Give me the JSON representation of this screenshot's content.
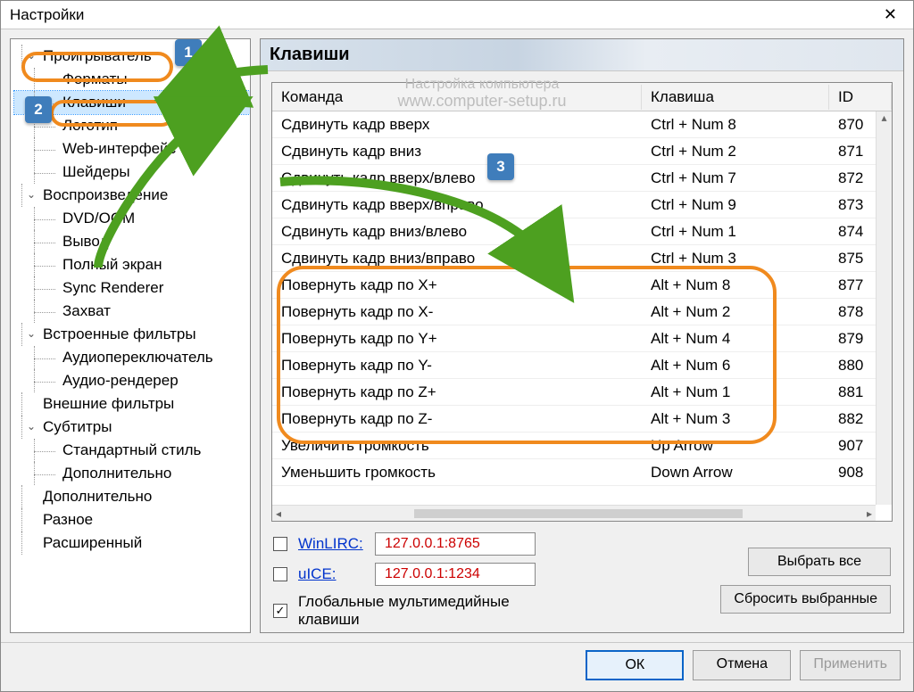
{
  "window": {
    "title": "Настройки"
  },
  "nav": {
    "tree": [
      {
        "label": "Проигрыватель",
        "expandable": true,
        "children": [
          {
            "label": "Форматы"
          },
          {
            "label": "Клавиши",
            "selected": true
          },
          {
            "label": "Логотип"
          },
          {
            "label": "Web-интерфейс"
          },
          {
            "label": "Шейдеры"
          }
        ]
      },
      {
        "label": "Воспроизведение",
        "expandable": true,
        "children": [
          {
            "label": "DVD/OGM"
          },
          {
            "label": "Вывод"
          },
          {
            "label": "Полный экран"
          },
          {
            "label": "Sync Renderer"
          },
          {
            "label": "Захват"
          }
        ]
      },
      {
        "label": "Встроенные фильтры",
        "expandable": true,
        "children": [
          {
            "label": "Аудиопереключатель"
          },
          {
            "label": "Аудио-рендерер"
          }
        ]
      },
      {
        "label": "Внешние фильтры",
        "expandable": false
      },
      {
        "label": "Субтитры",
        "expandable": true,
        "children": [
          {
            "label": "Стандартный стиль"
          },
          {
            "label": "Дополнительно"
          }
        ]
      },
      {
        "label": "Дополнительно",
        "expandable": false
      },
      {
        "label": "Разное",
        "expandable": false
      },
      {
        "label": "Расширенный",
        "expandable": false
      }
    ]
  },
  "section": {
    "title": "Клавиши"
  },
  "table": {
    "headers": {
      "cmd": "Команда",
      "key": "Клавиша",
      "id": "ID"
    },
    "rows": [
      {
        "cmd": "Сдвинуть кадр вверх",
        "key": "Ctrl + Num 8",
        "id": "870"
      },
      {
        "cmd": "Сдвинуть кадр вниз",
        "key": "Ctrl + Num 2",
        "id": "871"
      },
      {
        "cmd": "Сдвинуть кадр вверх/влево",
        "key": "Ctrl + Num 7",
        "id": "872"
      },
      {
        "cmd": "Сдвинуть кадр вверх/вправо",
        "key": "Ctrl + Num 9",
        "id": "873"
      },
      {
        "cmd": "Сдвинуть кадр вниз/влево",
        "key": "Ctrl + Num 1",
        "id": "874"
      },
      {
        "cmd": "Сдвинуть кадр вниз/вправо",
        "key": "Ctrl + Num 3",
        "id": "875"
      },
      {
        "cmd": "Повернуть кадр по X+",
        "key": "Alt + Num 8",
        "id": "877",
        "hl": true
      },
      {
        "cmd": "Повернуть кадр по X-",
        "key": "Alt + Num 2",
        "id": "878",
        "hl": true
      },
      {
        "cmd": "Повернуть кадр по Y+",
        "key": "Alt + Num 4",
        "id": "879",
        "hl": true
      },
      {
        "cmd": "Повернуть кадр по Y-",
        "key": "Alt + Num 6",
        "id": "880",
        "hl": true
      },
      {
        "cmd": "Повернуть кадр по Z+",
        "key": "Alt + Num 1",
        "id": "881",
        "hl": true
      },
      {
        "cmd": "Повернуть кадр по Z-",
        "key": "Alt + Num 3",
        "id": "882",
        "hl": true
      },
      {
        "cmd": "Увеличить громкость",
        "key": "Up Arrow",
        "id": "907"
      },
      {
        "cmd": "Уменьшить громкость",
        "key": "Down Arrow",
        "id": "908"
      }
    ]
  },
  "extras": {
    "winlirc": {
      "label": "WinLIRC:",
      "value": "127.0.0.1:8765",
      "checked": false
    },
    "uice": {
      "label": "uICE:",
      "value": "127.0.0.1:1234",
      "checked": false
    },
    "global": {
      "label": "Глобальные мультимедийные клавиши",
      "checked": true
    }
  },
  "buttons": {
    "select_all": "Выбрать все",
    "reset_sel": "Сбросить выбранные",
    "ok": "ОК",
    "cancel": "Отмена",
    "apply": "Применить"
  },
  "watermark": {
    "line1": "Настройка компьютера",
    "line2": "www.computer-setup.ru"
  },
  "callouts": {
    "b1": "1",
    "b2": "2",
    "b3": "3"
  }
}
